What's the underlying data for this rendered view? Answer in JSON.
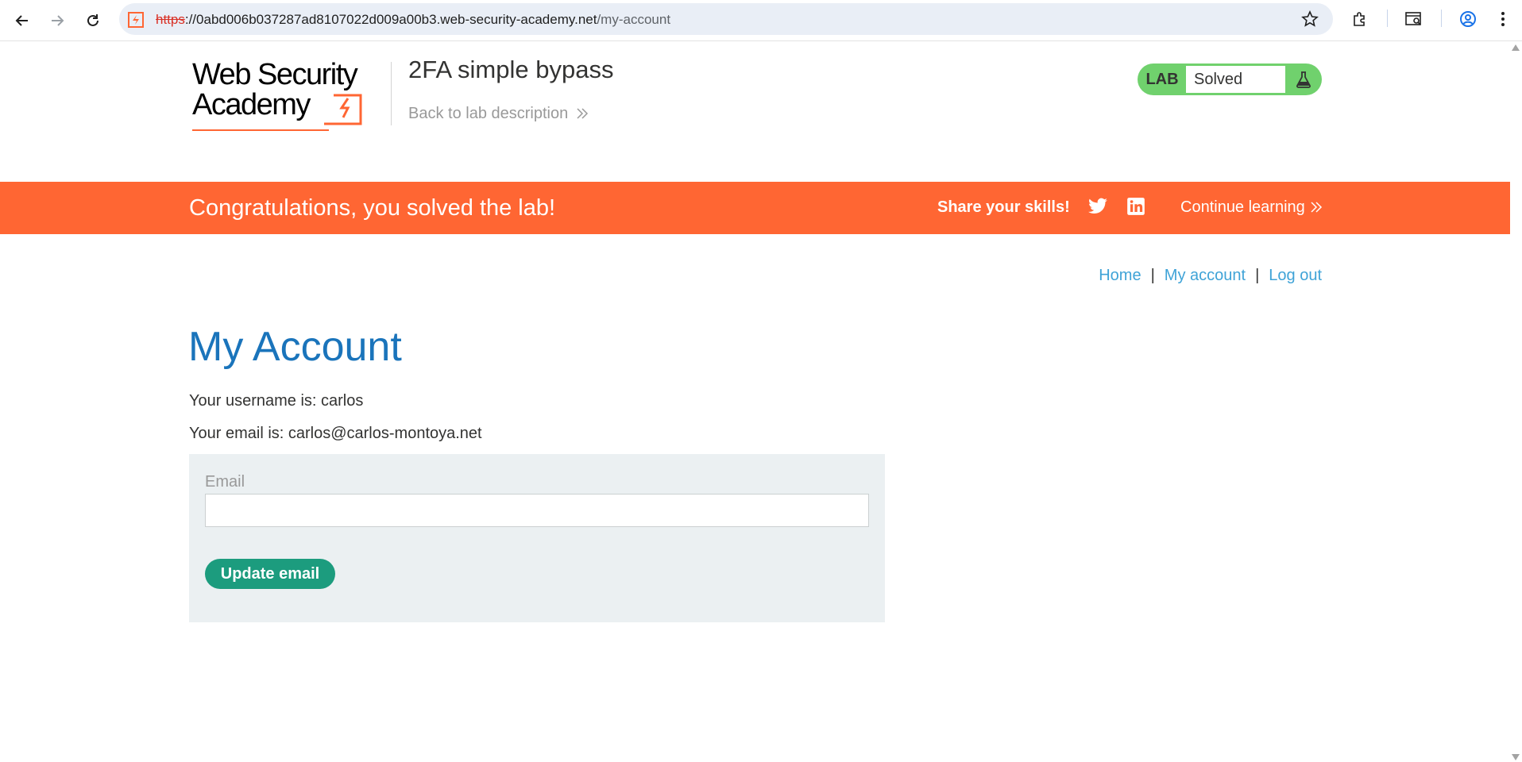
{
  "browser": {
    "url_protocol": "https",
    "url_separator": "://",
    "url_host": "0abd006b037287ad8107022d009a00b3.web-security-academy.net",
    "url_path": "/my-account"
  },
  "header": {
    "logo_text": "Web Security Academy",
    "lab_title": "2FA simple bypass",
    "back_link": "Back to lab description",
    "status_badge": "LAB",
    "status_text": "Solved"
  },
  "banner": {
    "message": "Congratulations, you solved the lab!",
    "share_label": "Share your skills!",
    "continue_label": "Continue learning"
  },
  "nav": {
    "home": "Home",
    "separator": "|",
    "my_account": "My account",
    "logout": "Log out"
  },
  "account": {
    "heading": "My Account",
    "username_line": "Your username is: carlos",
    "email_line": "Your email is: carlos@carlos-montoya.net",
    "email_field_label": "Email",
    "email_field_value": "",
    "update_button": "Update email"
  },
  "colors": {
    "banner": "#ff6633",
    "status": "#70d16d",
    "heading": "#1a74bb",
    "link": "#3fa3d7",
    "button": "#1c9c7e"
  }
}
